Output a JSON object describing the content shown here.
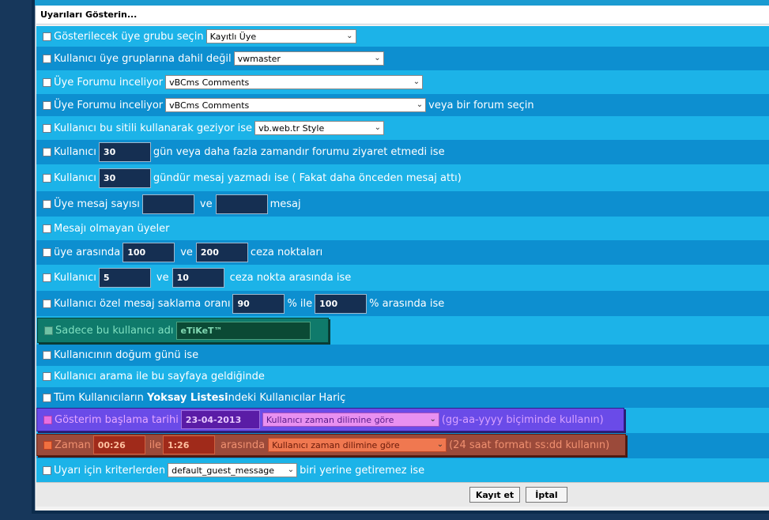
{
  "header": {
    "title": "Uyarıları Gösterin..."
  },
  "rows": {
    "r1": {
      "label": "Gösterilecek üye grubu seçin",
      "select": "Kayıtlı Üye"
    },
    "r2": {
      "label": "Kullanıcı üye gruplarına dahil değil",
      "select": "vwmaster"
    },
    "r3": {
      "label": "Üye Forumu inceliyor",
      "select": "vBCms Comments"
    },
    "r4": {
      "label": " Üye Forumu inceliyor",
      "select": "vBCms Comments",
      "suffix": "veya bir forum seçin"
    },
    "r5": {
      "label": "Kullanıcı bu sitili kullanarak geziyor ise",
      "select": "vb.web.tr Style"
    },
    "r6": {
      "label": "Kullanıcı",
      "value": "30",
      "suffix": "gün veya daha fazla zamandır forumu ziyaret etmedi ise"
    },
    "r7": {
      "label": "Kullanıcı",
      "value": "30",
      "suffix": "gündür mesaj yazmadı ise ( Fakat daha önceden mesaj attı)"
    },
    "r8": {
      "label": "Üye mesaj sayısı",
      "value1": "",
      "mid": "ve",
      "value2": "",
      "suffix": "mesaj"
    },
    "r9": {
      "label": "Mesajı olmayan üyeler"
    },
    "r10": {
      "label": "üye arasında",
      "value1": "100",
      "mid": "ve",
      "value2": "200",
      "suffix": "ceza noktaları"
    },
    "r11": {
      "label": "Kullanıcı",
      "value1": "5",
      "mid": "ve",
      "value2": "10",
      "suffix": "ceza nokta arasında ise"
    },
    "r12": {
      "label": "Kullanıcı özel mesaj saklama oranı",
      "value1": "90",
      "mid": "% ile",
      "value2": "100",
      "suffix": "% arasında ise"
    },
    "r13": {
      "label": "Sadece bu kullanıcı adı",
      "value": "eTiKeT™"
    },
    "r14": {
      "label": "Kullanıcının doğum günü ise"
    },
    "r15": {
      "label": "Kullanıcı arama ile bu sayfaya geldiğinde"
    },
    "r16": {
      "label_a": "Tüm Kullanıcıların ",
      "label_b": "Yoksay Listesi",
      "label_c": "ndeki Kullanıcılar Hariç"
    },
    "r17": {
      "label": "Gösterim başlama tarihi",
      "value": "23-04-2013",
      "select": "Kullanıcı zaman dilimine göre",
      "suffix": "(gg-aa-yyyy biçiminde kullanın)"
    },
    "r18": {
      "label": "Zaman",
      "value1": "00:26",
      "mid": "ile",
      "value2": "1:26",
      "mid2": "arasında",
      "select": "Kullanıcı zaman dilimine göre",
      "suffix": "(24 saat formatı ss:dd kullanın)"
    },
    "r19": {
      "label": "Uyarı için kriterlerden",
      "select": "default_guest_message",
      "suffix": "biri yerine getiremez ise"
    }
  },
  "footer": {
    "save": "Kayıt et",
    "cancel": "İptal"
  },
  "colors": {
    "row_light": "#1cb3e8",
    "row_dark": "#0d8fd0",
    "highlight_green": "#0f7a6b",
    "highlight_purple": "#6a4be8",
    "highlight_red": "#9b4a3a"
  }
}
